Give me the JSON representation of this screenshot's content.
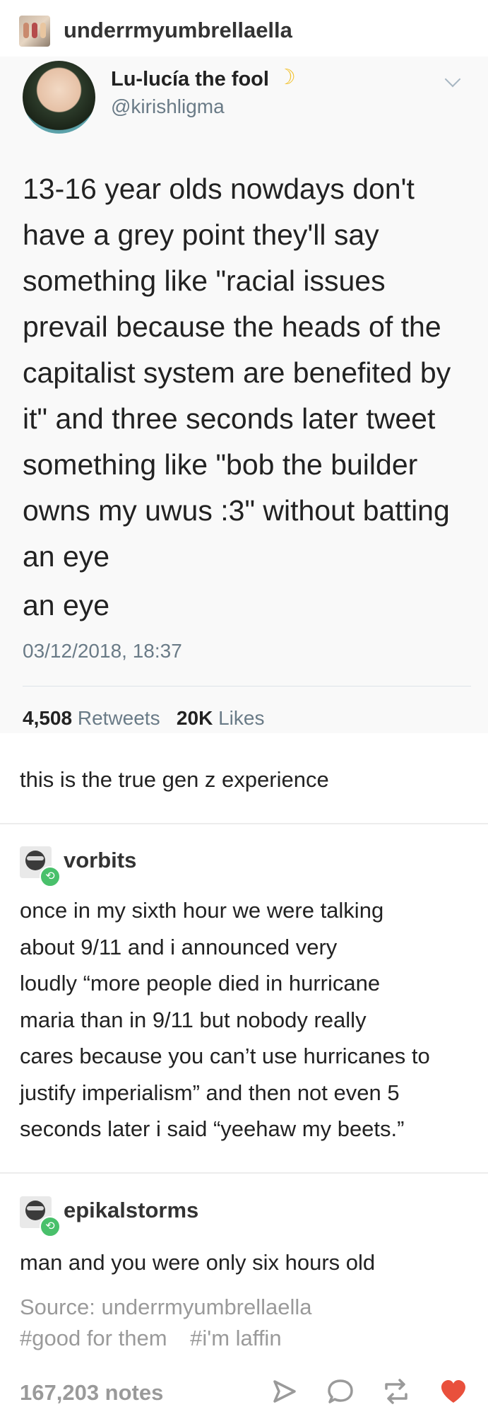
{
  "post": {
    "author": "underrmyumbrellaella"
  },
  "tweet": {
    "display_name": "Lu-lucía the fool",
    "emoji": "☽",
    "handle": "@kirishligma",
    "lines": [
      "13-16 year olds nowdays don't",
      "have a grey point they'll say",
      "something like \"racial issues",
      "prevail because the heads of the",
      "capitalist system are benefited by",
      "it\" and three seconds later tweet",
      "something like \"bob the builder",
      "owns my uwus :3\" without batting",
      "an eye",
      "an eye"
    ],
    "timestamp": "03/12/2018, 18:37",
    "retweets_count": "4,508",
    "retweets_label": "Retweets",
    "likes_count": "20K",
    "likes_label": "Likes"
  },
  "comment": "this is the true gen z experience",
  "reblogs": [
    {
      "username": "vorbits",
      "lines": [
        "once in my sixth hour we were talking",
        "about 9/11 and i announced very",
        "loudly “more people died in hurricane",
        "maria than in 9/11 but nobody really",
        "cares because you can’t use hurricanes to",
        "justify imperialism” and then not even 5",
        "seconds later i said “yeehaw my beets.”"
      ]
    },
    {
      "username": "epikalstorms",
      "lines": [
        "man and you were only six hours old"
      ]
    }
  ],
  "source": "Source: underrmyumbrellaella",
  "tags": [
    "#good for them",
    "#i'm laffin"
  ],
  "footer": {
    "notes": "167,203 notes"
  },
  "colors": {
    "accent_like": "#e9503c",
    "reblog_badge": "#49c06b",
    "muted_text": "#9a9a9a",
    "twitter_meta": "#6a7b87"
  },
  "icons": [
    "share-icon",
    "reply-icon",
    "reblog-icon",
    "heart-icon",
    "chevron-down-icon",
    "reblog-badge-icon"
  ]
}
